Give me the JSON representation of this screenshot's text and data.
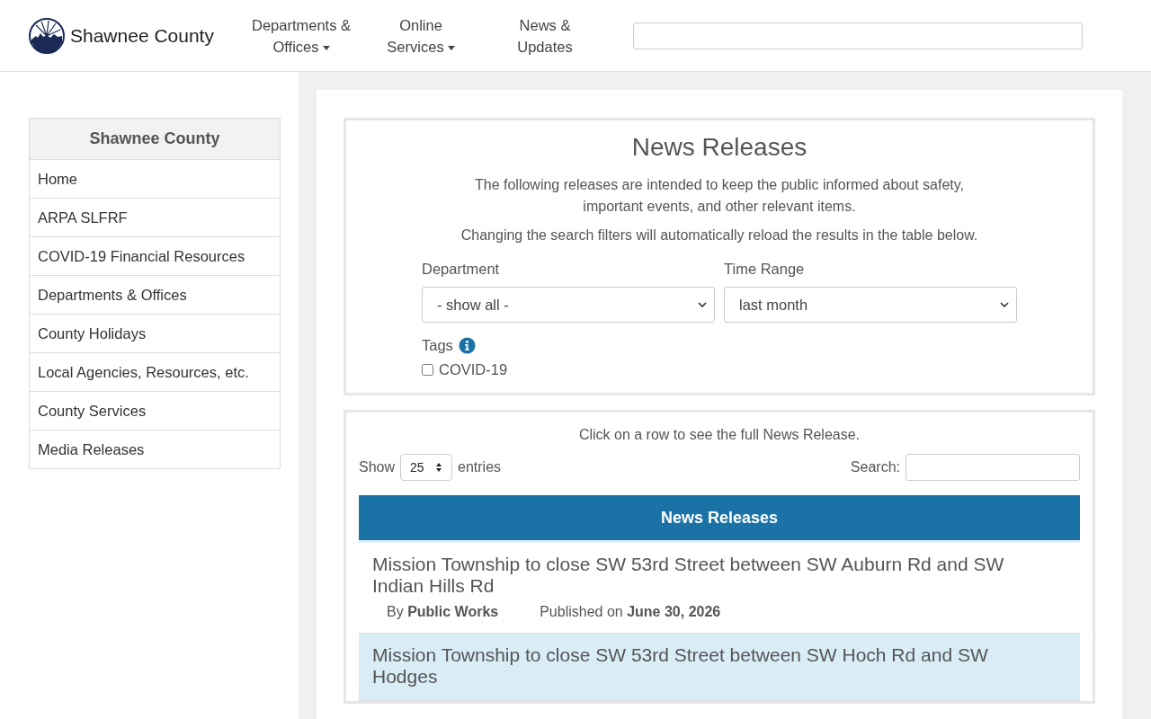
{
  "header": {
    "site_name": "Shawnee County",
    "nav": [
      {
        "label": "Departments &\nOffices",
        "dropdown": true
      },
      {
        "label": "Online\nServices",
        "dropdown": true
      },
      {
        "label": "News &\nUpdates",
        "dropdown": false
      }
    ]
  },
  "sidebar": {
    "title": "Shawnee County",
    "items": [
      "Home",
      "ARPA SLFRF",
      "COVID-19 Financial Resources",
      "Departments & Offices",
      "County Holidays",
      "Local Agencies, Resources, etc.",
      "County Services",
      "Media Releases"
    ]
  },
  "filters": {
    "title": "News Releases",
    "intro": "The following releases are intended to keep the public informed about safety, important events, and other relevant items.",
    "note": "Changing the search filters will automatically reload the results in the table below.",
    "department": {
      "label": "Department",
      "value": "- show all -"
    },
    "time_range": {
      "label": "Time Range",
      "value": "last month"
    },
    "tags": {
      "label": "Tags",
      "options": [
        {
          "label": "COVID-19",
          "checked": false
        }
      ]
    }
  },
  "table": {
    "hint": "Click on a row to see the full News Release.",
    "show_label": "Show",
    "page_size": "25",
    "entries_label": "entries",
    "search_label": "Search:",
    "heading": "News Releases",
    "rows": [
      {
        "title": "Mission Township to close SW 53rd Street between SW Auburn Rd and SW Indian Hills Rd",
        "by": "By **Public Works**",
        "published": "Published on **June 30, 2026**",
        "selected": false
      },
      {
        "title": "Mission Township to close SW 53rd Street between SW Hoch Rd and SW Hodges",
        "selected": true
      }
    ]
  }
}
